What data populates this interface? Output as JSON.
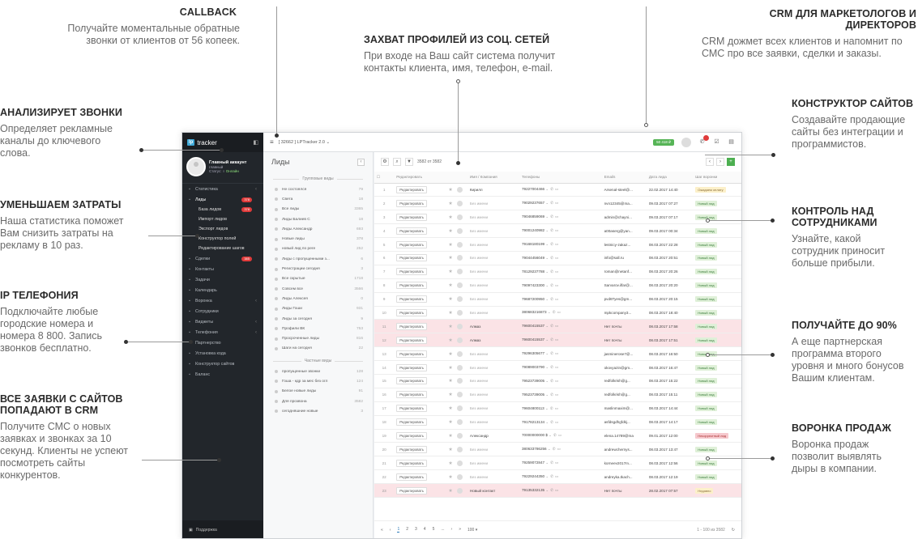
{
  "callouts": {
    "callback": {
      "title": "CALLBACK",
      "text": "Получайте моментальные обратные звонки от клиентов от 56 копеек."
    },
    "social": {
      "title": "ЗАХВАТ ПРОФИЛЕЙ ИЗ СОЦ. СЕТЕЙ",
      "text": "При входе на Ваш сайт система получит контакты клиента, имя, телефон, e-mail."
    },
    "crm": {
      "title": "CRM ДЛЯ МАРКЕТОЛОГОВ И ДИРЕКТОРОВ",
      "text": "CRM дожмет всех клиентов и напомнит по СМС про все заявки, сделки и заказы."
    },
    "analyze": {
      "title": "АНАЛИЗИРУЕТ ЗВОНКИ",
      "text": "Определяет рекламные каналы до ключевого слова."
    },
    "costs": {
      "title": "УМЕНЬШАЕМ ЗАТРАТЫ",
      "text": "Наша статистика поможет Вам снизить затраты на рекламу в 10 раз."
    },
    "ip": {
      "title": "IP ТЕЛЕФОНИЯ",
      "text": "Подключайте любые городские номера и номера 8 800.  Запись звонков бесплатно."
    },
    "requests": {
      "title": "ВСЕ ЗАЯВКИ  С САЙТОВ ПОПАДАЮТ В CRM",
      "text": "Получите СМС о новых заявках и звонках за 10 секунд. Клиенты не успеют  посмотреть сайты конкурентов."
    },
    "builder": {
      "title": "КОНСТРУКТОР САЙТОВ",
      "text": "Создавайте продающие сайты без интеграции и программистов."
    },
    "control": {
      "title": "КОНТРОЛЬ НАД СОТРУДНИКАМИ",
      "text": "Узнайте, какой сотрудник приносит больше прибыли."
    },
    "partner": {
      "title": "ПОЛУЧАЙТЕ ДО 90%",
      "text": "А еще партнерская программа второго уровня и много бонусов Вашим клиентам."
    },
    "funnel": {
      "title": "ВОРОНКА ПРОДАЖ",
      "text": "Воронка продаж позволит выявлять дыры в компании."
    }
  },
  "app": {
    "logo": "tracker",
    "logo_mark": "lp",
    "user": {
      "name": "Главный аккаунт",
      "role": "главный",
      "status_label": "Статус:",
      "status": "Онлайн"
    },
    "topbar": {
      "project": "[ 32662 ] LPTracker 2.0",
      "balance": "50 418 ₽"
    },
    "nav": [
      {
        "label": "Статистика",
        "icon": "chart-icon",
        "chevron": "‹"
      },
      {
        "label": "Лиды",
        "icon": "leads-icon",
        "badge": "378",
        "active": true
      },
      {
        "label": "Сделки",
        "icon": "deals-icon",
        "badge": "385"
      },
      {
        "label": "Контакты",
        "icon": "contacts-icon"
      },
      {
        "label": "Задачи",
        "icon": "tasks-icon"
      },
      {
        "label": "Календарь",
        "icon": "calendar-icon"
      },
      {
        "label": "Воронка",
        "icon": "funnel-icon",
        "chevron": "‹"
      },
      {
        "label": "Сотрудники",
        "icon": "staff-icon"
      },
      {
        "label": "Виджеты",
        "icon": "widgets-icon",
        "chevron": "‹"
      },
      {
        "label": "Телефония",
        "icon": "phone-icon",
        "chevron": "‹"
      },
      {
        "label": "Партнерство",
        "icon": "partner-icon"
      },
      {
        "label": "Установка кода",
        "icon": "code-icon"
      },
      {
        "label": "Конструктор сайтов",
        "icon": "builder-icon"
      },
      {
        "label": "Баланс",
        "icon": "balance-icon"
      }
    ],
    "subnav": [
      {
        "label": "База лидов",
        "badge": "378"
      },
      {
        "label": "Импорт лидов"
      },
      {
        "label": "Экспорт лидов"
      },
      {
        "label": "Конструктор полей"
      },
      {
        "label": "Редактирование шагов"
      }
    ],
    "support": "Поддержка",
    "leftpane": {
      "title": "Лиды",
      "group1": "Групповые виды",
      "filters1": [
        {
          "label": "Не состоялся",
          "count": "79"
        },
        {
          "label": "Света",
          "count": "18"
        },
        {
          "label": "Все лиды",
          "count": "3365"
        },
        {
          "label": "Лиды Балиев С",
          "count": "18"
        },
        {
          "label": "Лиды Александр",
          "count": "693"
        },
        {
          "label": "Новые лиды",
          "count": "378"
        },
        {
          "label": "новый лид по реге",
          "count": "252"
        },
        {
          "label": "Лиды с пропущенными з...",
          "count": "6"
        },
        {
          "label": "Регистрации сегодня",
          "count": "3"
        },
        {
          "label": "Все скрытые",
          "count": "1718"
        },
        {
          "label": "Совсем все",
          "count": "3566"
        },
        {
          "label": "Лиды Алексея",
          "count": "0"
        },
        {
          "label": "Лиды Гоши",
          "count": "931"
        },
        {
          "label": "Лиды за сегодня",
          "count": "9"
        },
        {
          "label": "Профили ВК",
          "count": "753"
        },
        {
          "label": "Просроченные лиды",
          "count": "816"
        },
        {
          "label": "Шаги на сегодня",
          "count": "22"
        }
      ],
      "group2": "Частные виды",
      "filters2": [
        {
          "label": "пропущенные звонки",
          "count": "128"
        },
        {
          "label": "Гоша - кдр за мес без огл",
          "count": "124"
        },
        {
          "label": "Белое новые лиды",
          "count": "91"
        },
        {
          "label": "Для прозвона",
          "count": "3582"
        },
        {
          "label": "сегодняшние новые",
          "count": "3"
        }
      ]
    },
    "toolbar": {
      "count": "3582 от 3582"
    },
    "table": {
      "headers": [
        "Редактировать",
        "Имя / Компания",
        "Телефоны",
        "Emails",
        "Дата лида",
        "Шаг воронки"
      ],
      "edit_label": "Редактировать",
      "rows": [
        {
          "n": "1",
          "name": "Кирилл",
          "phone": "79227004466",
          "email": "Arsenal-steel@...",
          "date": "22.02.2017 14:40",
          "step": "Ожидаем оплату",
          "st": "wait"
        },
        {
          "n": "2",
          "name": "Без имени",
          "phone": "79029237657",
          "email": "nvn12345@ma...",
          "date": "09.03.2017 07:27",
          "step": "Новый лид"
        },
        {
          "n": "3",
          "name": "Без имени",
          "phone": "79046859069",
          "email": "admin@chayni...",
          "date": "09.03.2017 07:17",
          "step": "Новый лид"
        },
        {
          "n": "4",
          "name": "Без имени",
          "phone": "79001240982",
          "email": "a00aserg@yan...",
          "date": "09.03.2017 00:34",
          "step": "Новый лид"
        },
        {
          "n": "5",
          "name": "Без имени",
          "phone": "79168180199",
          "email": "lestnicy-zakaz...",
          "date": "08.03.2017 22:28",
          "step": "Новый лид"
        },
        {
          "n": "6",
          "name": "Без имени",
          "phone": "79044456049",
          "email": "info@sall.ru",
          "date": "08.03.2017 20:51",
          "step": "Новый лид"
        },
        {
          "n": "7",
          "name": "Без имени",
          "phone": "78129237788",
          "email": "roman@netanf...",
          "date": "08.03.2017 20:26",
          "step": "Новый лид"
        },
        {
          "n": "8",
          "name": "Без имени",
          "phone": "79097423300",
          "email": "Sarvarov.ilfar@...",
          "date": "08.03.2017 20:20",
          "step": "Новый лид"
        },
        {
          "n": "9",
          "name": "Без имени",
          "phone": "79687200950",
          "email": "pvd6Tyes@gm...",
          "date": "08.03.2017 20:15",
          "step": "Новый лид"
        },
        {
          "n": "10",
          "name": "Без имени",
          "phone": "380683216873",
          "email": "mpkcompany3...",
          "date": "08.03.2017 18:40",
          "step": "Новый лид"
        },
        {
          "n": "11",
          "name": "Алмаз",
          "phone": "79600415537",
          "email": "Нет почты",
          "date": "08.03.2017 17:58",
          "step": "Новый лид",
          "red": true
        },
        {
          "n": "12",
          "name": "Алмаз",
          "phone": "79600415537",
          "email": "Нет почты",
          "date": "08.03.2017 17:51",
          "step": "Новый лид",
          "red": true
        },
        {
          "n": "13",
          "name": "Без имени",
          "phone": "79296305677",
          "email": "jasminerose7@...",
          "date": "08.03.2017 16:50",
          "step": "Новый лид"
        },
        {
          "n": "14",
          "name": "Без имени",
          "phone": "79089003790",
          "email": "okovyazin@gm...",
          "date": "08.03.2017 16:47",
          "step": "Новый лид"
        },
        {
          "n": "15",
          "name": "Без имени",
          "phone": "79523739005",
          "email": "redfolkrish@g...",
          "date": "08.03.2017 15:22",
          "step": "Новый лид"
        },
        {
          "n": "16",
          "name": "Без имени",
          "phone": "79523739005",
          "email": "redfolkrish@g...",
          "date": "08.03.2017 15:11",
          "step": "Новый лид"
        },
        {
          "n": "17",
          "name": "Без имени",
          "phone": "79604800113",
          "email": "maslinmaxim@...",
          "date": "08.03.2017 14:44",
          "step": "Новый лид"
        },
        {
          "n": "18",
          "name": "Без имени",
          "phone": "79178213134",
          "email": "asfdsgdhgfdkj...",
          "date": "08.03.2017 14:17",
          "step": "Новый лид"
        },
        {
          "n": "19",
          "name": "Александр",
          "phone": "70000000000 $",
          "email": "elena.14789@ma",
          "date": "09.01.2017 12:00",
          "step": "Некорректный лид",
          "st": "bad"
        },
        {
          "n": "20",
          "name": "Без имени",
          "phone": "380633786256",
          "email": "andrewchernys...",
          "date": "08.03.2017 13:47",
          "step": "Новый лид"
        },
        {
          "n": "21",
          "name": "Без имени",
          "phone": "79259072847",
          "email": "korneev2017m...",
          "date": "08.03.2017 12:56",
          "step": "Новый лид"
        },
        {
          "n": "22",
          "name": "Без имени",
          "phone": "79229244350",
          "email": "andreyka.tkach...",
          "date": "08.03.2017 12:19",
          "step": "Новый лид"
        },
        {
          "n": "23",
          "name": "Новый контакт",
          "phone": "79135332135",
          "email": "Нет почты",
          "date": "28.02.2017 07:57",
          "step": "Недавно",
          "st": "wait",
          "red": true
        }
      ]
    },
    "pager": {
      "pages": [
        "1",
        "2",
        "3",
        "4",
        "5",
        "...",
        "›",
        "»"
      ],
      "per_page": "100",
      "range": "1 - 100 из 3582"
    }
  }
}
